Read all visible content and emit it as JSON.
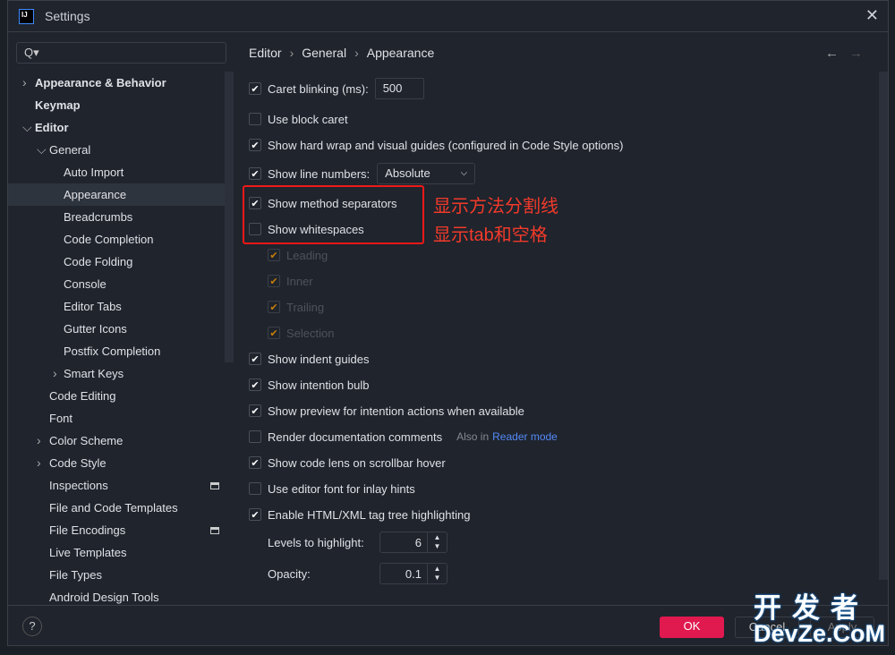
{
  "window": {
    "title": "Settings",
    "logo": "IJ",
    "close_icon": "close-icon"
  },
  "search": {
    "placeholder": "Q▾"
  },
  "tree": [
    {
      "label": "Appearance & Behavior",
      "level": 0,
      "arrow": "›",
      "bold": true
    },
    {
      "label": "Keymap",
      "level": 0,
      "bold": true
    },
    {
      "label": "Editor",
      "level": 0,
      "arrow": "⌄",
      "bold": true
    },
    {
      "label": "General",
      "level": 1,
      "arrow": "⌄"
    },
    {
      "label": "Auto Import",
      "level": 2
    },
    {
      "label": "Appearance",
      "level": 2,
      "selected": true
    },
    {
      "label": "Breadcrumbs",
      "level": 2
    },
    {
      "label": "Code Completion",
      "level": 2
    },
    {
      "label": "Code Folding",
      "level": 2
    },
    {
      "label": "Console",
      "level": 2
    },
    {
      "label": "Editor Tabs",
      "level": 2
    },
    {
      "label": "Gutter Icons",
      "level": 2
    },
    {
      "label": "Postfix Completion",
      "level": 2
    },
    {
      "label": "Smart Keys",
      "level": 2,
      "arrow": "›"
    },
    {
      "label": "Code Editing",
      "level": 1
    },
    {
      "label": "Font",
      "level": 1
    },
    {
      "label": "Color Scheme",
      "level": 1,
      "arrow": "›"
    },
    {
      "label": "Code Style",
      "level": 1,
      "arrow": "›"
    },
    {
      "label": "Inspections",
      "level": 1,
      "badge": true
    },
    {
      "label": "File and Code Templates",
      "level": 1
    },
    {
      "label": "File Encodings",
      "level": 1,
      "badge": true
    },
    {
      "label": "Live Templates",
      "level": 1
    },
    {
      "label": "File Types",
      "level": 1
    },
    {
      "label": "Android Design Tools",
      "level": 1
    }
  ],
  "breadcrumb": [
    "Editor",
    "General",
    "Appearance"
  ],
  "nav": {
    "back": "←",
    "forward": "→"
  },
  "options": {
    "caret_blinking": {
      "label": "Caret blinking (ms):",
      "checked": true,
      "value": "500"
    },
    "block_caret": {
      "label": "Use block caret",
      "checked": false
    },
    "hard_wrap": {
      "label": "Show hard wrap and visual guides (configured in Code Style options)",
      "checked": true
    },
    "line_numbers": {
      "label": "Show line numbers:",
      "checked": true,
      "value": "Absolute"
    },
    "method_separators": {
      "label": "Show method separators",
      "checked": true
    },
    "whitespaces": {
      "label": "Show whitespaces",
      "checked": false
    },
    "leading": {
      "label": "Leading",
      "checked": true
    },
    "inner": {
      "label": "Inner",
      "checked": true
    },
    "trailing": {
      "label": "Trailing",
      "checked": true
    },
    "selection": {
      "label": "Selection",
      "checked": true
    },
    "indent_guides": {
      "label": "Show indent guides",
      "checked": true
    },
    "intention_bulb": {
      "label": "Show intention bulb",
      "checked": true
    },
    "preview_intention": {
      "label": "Show preview for intention actions when available",
      "checked": true
    },
    "render_docs": {
      "label": "Render documentation comments",
      "checked": false,
      "hint": "Also in",
      "link": "Reader mode"
    },
    "code_lens": {
      "label": "Show code lens on scrollbar hover",
      "checked": true
    },
    "editor_font_inlay": {
      "label": "Use editor font for inlay hints",
      "checked": false
    },
    "tag_tree": {
      "label": "Enable HTML/XML tag tree highlighting",
      "checked": true
    },
    "levels": {
      "label": "Levels to highlight:",
      "value": "6"
    },
    "opacity": {
      "label": "Opacity:",
      "value": "0.1"
    }
  },
  "annotations": {
    "method": "显示方法分割线",
    "whitespace": "显示tab和空格",
    "color": "#f21818"
  },
  "footer": {
    "help": "?",
    "ok": "OK",
    "cancel": "Cancel",
    "apply": "Apply",
    "ok_color": "#e0194f"
  },
  "watermark": {
    "line1": "开发者",
    "line2": "DevZe.CoM"
  }
}
